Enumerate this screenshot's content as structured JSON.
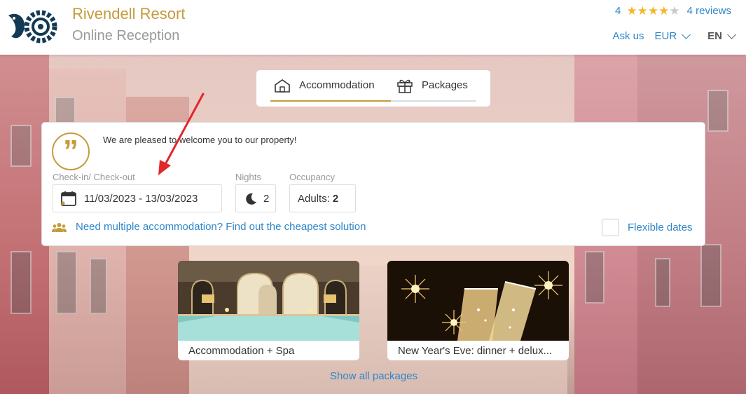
{
  "header": {
    "title": "Rivendell Resort",
    "subtitle": "Online Reception",
    "rating": {
      "value": "4",
      "stars": 4,
      "max_stars": 5,
      "reviews": "4 reviews"
    },
    "ask_us": "Ask us",
    "currency": "EUR",
    "language": "EN"
  },
  "tabs": [
    {
      "label": "Accommodation",
      "active": true
    },
    {
      "label": "Packages",
      "active": false
    }
  ],
  "booking": {
    "welcome": "We are pleased to welcome you to our property!",
    "checkin_label": "Check-in/ Check-out",
    "dates": "11/03/2023 - 13/03/2023",
    "nights_label": "Nights",
    "nights": "2",
    "occupancy_label": "Occupancy",
    "adults_label": "Adults:",
    "adults": "2",
    "multi_link": "Need multiple accommodation? Find out the cheapest solution",
    "flexible_label": "Flexible dates",
    "flexible_checked": false
  },
  "packages": [
    {
      "title": "Accommodation + Spa",
      "image": "indoor-pool-image"
    },
    {
      "title": "New Year's Eve: dinner + delux...",
      "image": "champagne-sparklers-image"
    }
  ],
  "show_all": "Show all packages",
  "colors": {
    "accent": "#c59b3c",
    "link": "#2f86c9",
    "annotation": "#e3262b",
    "star": "#f3b72b"
  }
}
